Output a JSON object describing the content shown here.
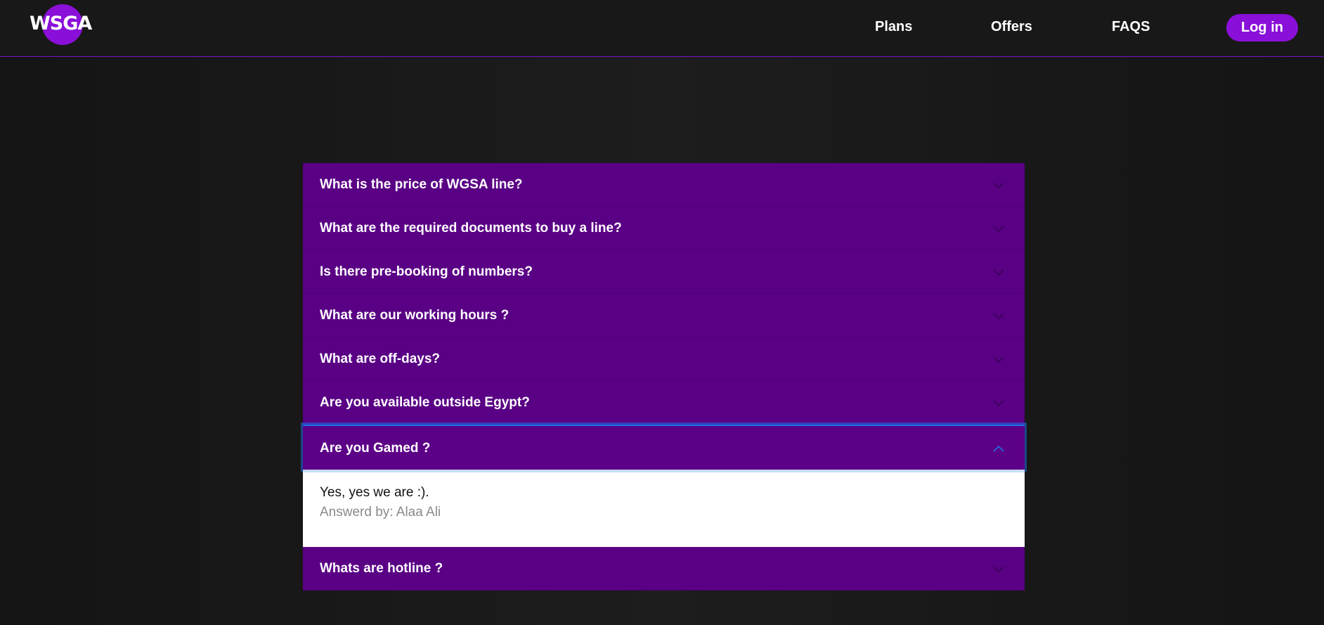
{
  "brand": {
    "logo_text": "WSGA",
    "accent": "#8a0fd8"
  },
  "nav": {
    "plans": "Plans",
    "offers": "Offers",
    "faqs": "FAQS",
    "login": "Log in"
  },
  "faq": {
    "items": [
      {
        "question": "What is the price of WGSA line?"
      },
      {
        "question": "What are the required documents to buy a line?"
      },
      {
        "question": "Is there pre-booking of numbers?"
      },
      {
        "question": "What are our working hours ?"
      },
      {
        "question": "What are off-days?"
      },
      {
        "question": "Are you available outside Egypt?"
      },
      {
        "question": "Are you Gamed ?",
        "answer": "Yes, yes we are :).",
        "answered_by": "Answerd by: Alaa Ali",
        "expanded": true
      },
      {
        "question": "Whats are hotline ?"
      }
    ]
  },
  "icons": {
    "collapsed": "chevron-down-icon",
    "expanded": "chevron-up-icon"
  }
}
